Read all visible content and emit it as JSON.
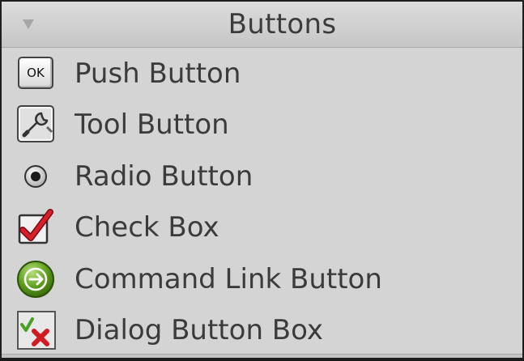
{
  "header": {
    "title": "Buttons",
    "collapse_icon": "triangle-down-icon"
  },
  "items": [
    {
      "label": "Push Button",
      "icon": "ok-icon",
      "icon_text": "OK"
    },
    {
      "label": "Tool Button",
      "icon": "wrench-icon"
    },
    {
      "label": "Radio Button",
      "icon": "radio-icon"
    },
    {
      "label": "Check Box",
      "icon": "checkbox-icon"
    },
    {
      "label": "Command Link Button",
      "icon": "arrow-circle-icon"
    },
    {
      "label": "Dialog Button Box",
      "icon": "dialog-buttons-icon"
    }
  ]
}
